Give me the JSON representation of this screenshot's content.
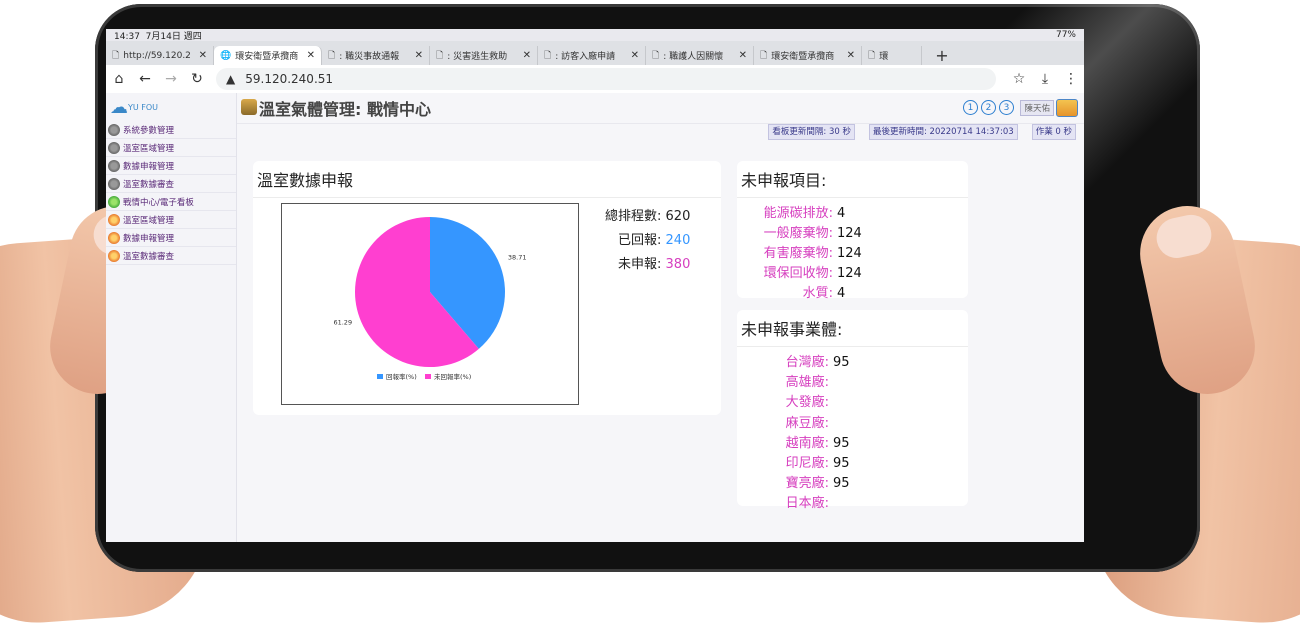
{
  "device_status": {
    "time": "14:37",
    "date": "7月14日 週四",
    "battery": "77%"
  },
  "browser": {
    "tabs": [
      {
        "label": "http://59.120.2",
        "active": false
      },
      {
        "label": "環安衛暨承攬商",
        "active": true
      },
      {
        "label": ": 職災事故通報",
        "active": false
      },
      {
        "label": ": 災害逃生救助",
        "active": false
      },
      {
        "label": ": 訪客入廠申請",
        "active": false
      },
      {
        "label": ": 職護人因關懷",
        "active": false
      },
      {
        "label": "環安衛暨承攬商",
        "active": false
      },
      {
        "label": "環",
        "active": false
      }
    ],
    "url": "59.120.240.51"
  },
  "sidebar": {
    "logo_text": "YU FOU",
    "items": [
      {
        "label": "系統參數管理",
        "icon": "gear-icon"
      },
      {
        "label": "溫室區域管理",
        "icon": "gear-icon"
      },
      {
        "label": "數據申報管理",
        "icon": "gear-icon"
      },
      {
        "label": "溫室數據審查",
        "icon": "gear-icon"
      },
      {
        "label": "戰情中心/電子看板",
        "icon": "green-ball-icon"
      },
      {
        "label": "溫室區域管理",
        "icon": "orange-ball-icon"
      },
      {
        "label": "數據申報管理",
        "icon": "orange-ball-icon"
      },
      {
        "label": "溫室數據審查",
        "icon": "orange-ball-icon"
      }
    ]
  },
  "header": {
    "title": "溫室氣體管理: 戰情中心",
    "page_buttons": [
      "1",
      "2",
      "3"
    ],
    "user": "陳天佑",
    "refresh_interval": "看板更新間隔: 30 秒",
    "last_update": "最後更新時間: 20220714 14:37:03",
    "job": "作業 0 秒"
  },
  "report_panel": {
    "title": "溫室數據申報",
    "total_label": "總排程數:",
    "total_value": "620",
    "reported_label": "已回報:",
    "reported_value": "240",
    "unreported_label": "未申報:",
    "unreported_value": "380"
  },
  "chart_data": {
    "type": "pie",
    "slices": [
      {
        "name": "回報率(%)",
        "value": 38.71,
        "color": "#3596ff"
      },
      {
        "name": "未回報率(%)",
        "value": 61.29,
        "color": "#ff3fd0"
      }
    ],
    "labels": [
      "38.71",
      "61.29"
    ],
    "legend": "bottom"
  },
  "unreported_items": {
    "title": "未申報項目:",
    "rows": [
      {
        "label": "能源碳排放:",
        "value": "4"
      },
      {
        "label": "一般廢棄物:",
        "value": "124"
      },
      {
        "label": "有害廢棄物:",
        "value": "124"
      },
      {
        "label": "環保回收物:",
        "value": "124"
      },
      {
        "label": "水質:",
        "value": "4"
      }
    ]
  },
  "unreported_entities": {
    "title": "未申報事業體:",
    "rows": [
      {
        "label": "台灣廠:",
        "value": "95"
      },
      {
        "label": "高雄廠:",
        "value": ""
      },
      {
        "label": "大發廠:",
        "value": ""
      },
      {
        "label": "麻豆廠:",
        "value": ""
      },
      {
        "label": "越南廠:",
        "value": "95"
      },
      {
        "label": "印尼廠:",
        "value": "95"
      },
      {
        "label": "寶亮廠:",
        "value": "95"
      },
      {
        "label": "日本廠:",
        "value": ""
      }
    ]
  },
  "colors": {
    "reported": "#3596ff",
    "unreported": "#ff3fd0",
    "label_pink": "#d63fbf"
  }
}
